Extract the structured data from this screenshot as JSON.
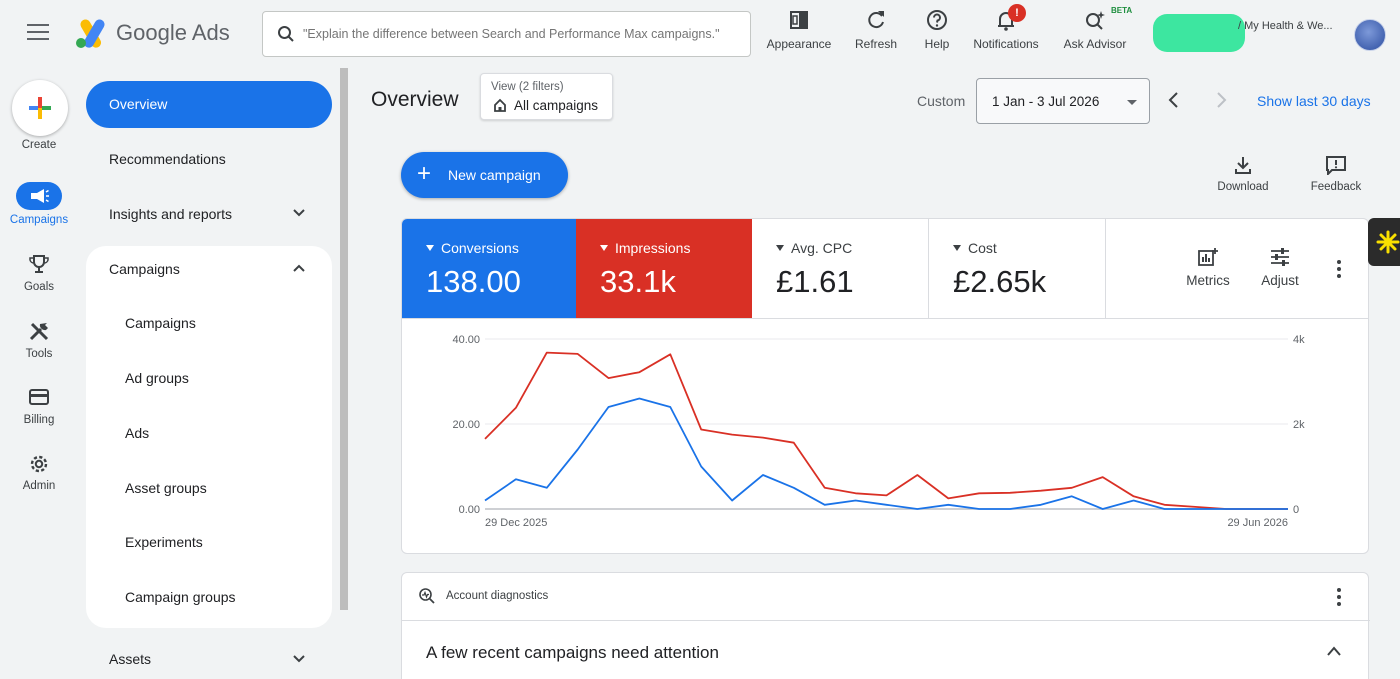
{
  "app": {
    "brand": "Google Ads",
    "search_placeholder": "\"Explain the difference between Search and Performance Max campaigns.\""
  },
  "toolbar": {
    "appearance": "Appearance",
    "refresh": "Refresh",
    "help": "Help",
    "notifications": "Notifications",
    "notifications_badge": "!",
    "ask_advisor": "Ask Advisor",
    "beta": "BETA",
    "account_name": "/ My Health & We..."
  },
  "rail": {
    "create": "Create",
    "campaigns": "Campaigns",
    "goals": "Goals",
    "tools": "Tools",
    "billing": "Billing",
    "admin": "Admin"
  },
  "nav": {
    "overview": "Overview",
    "recommendations": "Recommendations",
    "insights": "Insights and reports",
    "campaigns_group": "Campaigns",
    "sub": [
      "Campaigns",
      "Ad groups",
      "Ads",
      "Asset groups",
      "Experiments",
      "Campaign groups"
    ],
    "assets": "Assets"
  },
  "header": {
    "title": "Overview",
    "filter_small": "View (2 filters)",
    "filter_main": "All campaigns",
    "date_label": "Custom",
    "date_range": "1 Jan - 3 Jul 2026",
    "show_last": "Show last 30 days"
  },
  "actions": {
    "new_campaign": "New campaign",
    "download": "Download",
    "feedback": "Feedback"
  },
  "metrics": [
    {
      "label": "Conversions",
      "value": "138.00"
    },
    {
      "label": "Impressions",
      "value": "33.1k"
    },
    {
      "label": "Avg. CPC",
      "value": "£1.61"
    },
    {
      "label": "Cost",
      "value": "£2.65k"
    }
  ],
  "chart_tools": {
    "metrics": "Metrics",
    "adjust": "Adjust"
  },
  "chart_data": {
    "type": "line",
    "x_start_label": "29 Dec 2025",
    "x_end_label": "29 Jun 2026",
    "left_axis": {
      "ticks": [
        "0.00",
        "20.00",
        "40.00"
      ],
      "range": [
        0,
        40
      ]
    },
    "right_axis": {
      "ticks": [
        "0",
        "2k",
        "4k"
      ],
      "range": [
        0,
        4000
      ]
    },
    "colors": {
      "conversions": "#1a73e8",
      "impressions": "#d93025"
    },
    "series": [
      {
        "name": "Conversions",
        "axis": "left",
        "values": [
          2,
          7,
          5,
          14,
          24,
          26,
          24,
          10,
          2,
          8,
          5,
          1,
          2,
          1,
          0,
          1,
          0,
          0,
          1,
          3,
          0,
          2,
          0,
          0,
          0,
          0,
          0
        ]
      },
      {
        "name": "Impressions",
        "axis": "right",
        "values": [
          1650,
          2380,
          3680,
          3650,
          3080,
          3220,
          3640,
          1870,
          1750,
          1680,
          1560,
          500,
          370,
          320,
          800,
          250,
          370,
          380,
          430,
          500,
          750,
          300,
          100,
          50,
          0,
          0,
          0
        ]
      }
    ]
  },
  "diagnostics": {
    "head": "Account diagnostics",
    "title": "A few recent campaigns need attention"
  }
}
